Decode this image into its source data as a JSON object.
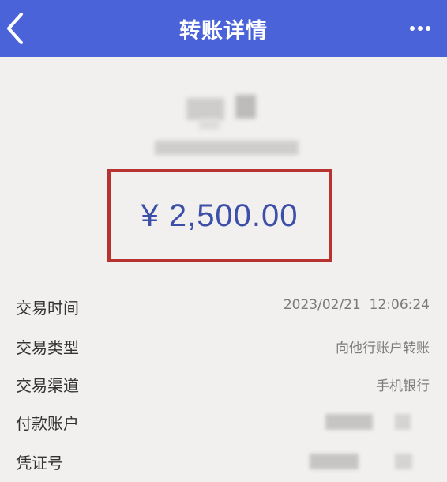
{
  "header": {
    "title": "转账详情",
    "back_icon": "chevron-left-icon",
    "more_icon": "more-horizontal-icon"
  },
  "amount": {
    "text": "¥ 2,500.00",
    "color": "#3d4fa8",
    "box_color": "#b8332f"
  },
  "details": [
    {
      "label": "交易时间",
      "value": "2023/02/21  12:06:24"
    },
    {
      "label": "交易类型",
      "value": "向他行账户转账"
    },
    {
      "label": "交易渠道",
      "value": "手机银行"
    },
    {
      "label": "付款账户",
      "value": ""
    },
    {
      "label": "凭证号",
      "value": ""
    }
  ],
  "colors": {
    "header_bg": "#4a63d8",
    "page_bg": "#f1f0ee"
  }
}
